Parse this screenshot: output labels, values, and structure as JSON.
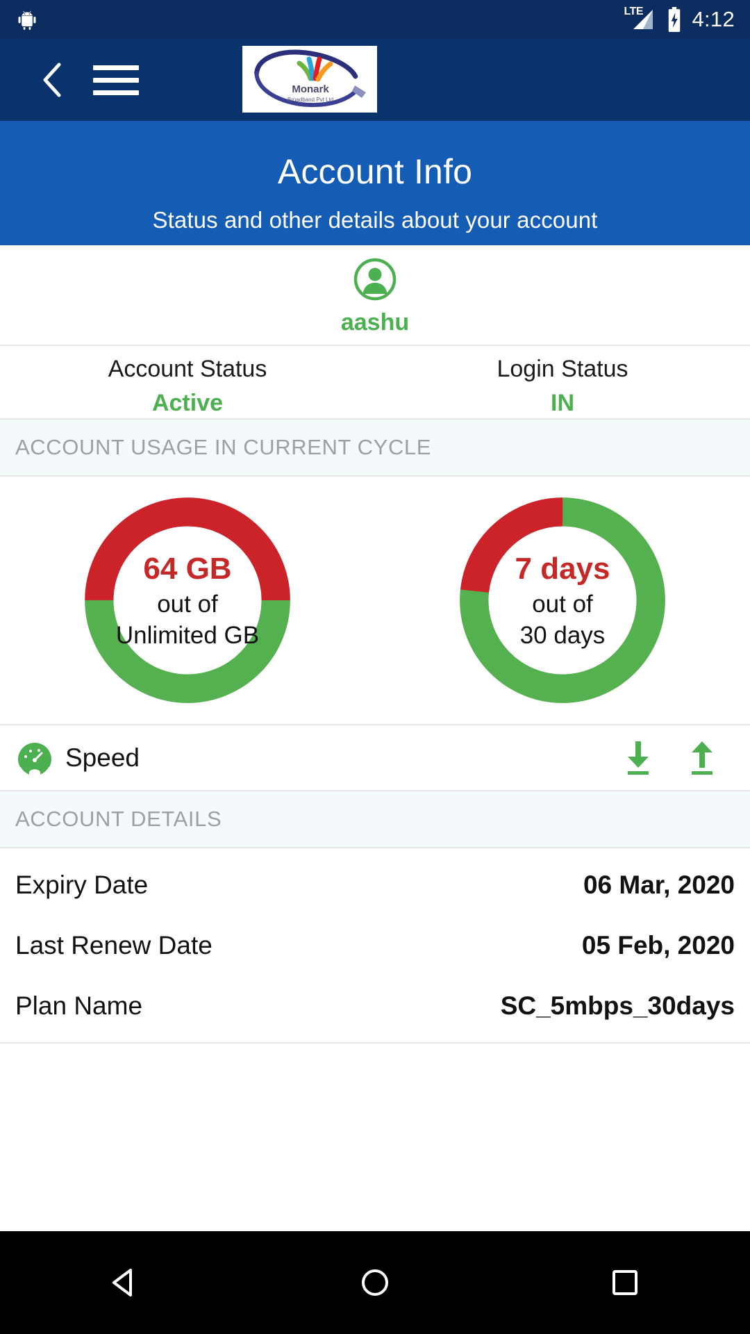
{
  "status_bar": {
    "time": "4:12",
    "network_label": "LTE",
    "icons": [
      "android-robot-icon",
      "lte-signal-icon",
      "battery-charging-icon"
    ]
  },
  "app_bar": {
    "back_icon": "chevron-left-icon",
    "menu_icon": "hamburger-menu-icon",
    "logo_title": "Monark",
    "logo_subtitle": "Broadband Pvt Ltd",
    "bg_color": "#0a336b"
  },
  "hero": {
    "title": "Account Info",
    "subtitle": "Status and other details about your account",
    "bg_color": "#155cb4"
  },
  "profile": {
    "avatar_icon": "user-avatar-icon",
    "username": "aashu",
    "accent_color": "#4caf50"
  },
  "status_row": {
    "items": [
      {
        "label": "Account Status",
        "value": "Active"
      },
      {
        "label": "Login Status",
        "value": "IN"
      }
    ]
  },
  "sections": {
    "usage_header": "ACCOUNT USAGE IN CURRENT CYCLE",
    "details_header": "ACCOUNT DETAILS"
  },
  "speed_row": {
    "label": "Speed",
    "icon": "speedometer-icon",
    "download_icon": "download-arrow-icon",
    "upload_icon": "upload-arrow-icon"
  },
  "details": {
    "rows": [
      {
        "key": "Expiry Date",
        "value": "06 Mar, 2020"
      },
      {
        "key": "Last Renew Date",
        "value": "05 Feb, 2020"
      },
      {
        "key": "Plan Name",
        "value": "SC_5mbps_30days"
      }
    ]
  },
  "nav_bar": {
    "back_icon": "nav-back-triangle-icon",
    "home_icon": "nav-home-circle-icon",
    "recents_icon": "nav-recents-square-icon"
  },
  "colors": {
    "used": "#cc2229",
    "remaining": "#55b04f",
    "accent_green": "#4caf50",
    "red_text": "#c62828"
  },
  "chart_data": [
    {
      "type": "pie",
      "title": "Data Usage",
      "center_value": "64 GB",
      "center_mid": "out of",
      "center_sub": "Unlimited GB",
      "slices": [
        {
          "name": "Used",
          "value": 50,
          "color": "#cc2229"
        },
        {
          "name": "Remaining",
          "value": 50,
          "color": "#55b04f"
        }
      ],
      "used_label": "64 GB",
      "total_label": "Unlimited GB",
      "legend": "hidden",
      "donut": true
    },
    {
      "type": "pie",
      "title": "Days Usage",
      "center_value": "7 days",
      "center_mid": "out of",
      "center_sub": "30 days",
      "slices": [
        {
          "name": "Remaining",
          "value": 23,
          "color": "#55b04f"
        },
        {
          "name": "Used",
          "value": 7,
          "color": "#cc2229"
        }
      ],
      "used_label": "7 days",
      "total_label": "30 days",
      "legend": "hidden",
      "donut": true
    }
  ]
}
